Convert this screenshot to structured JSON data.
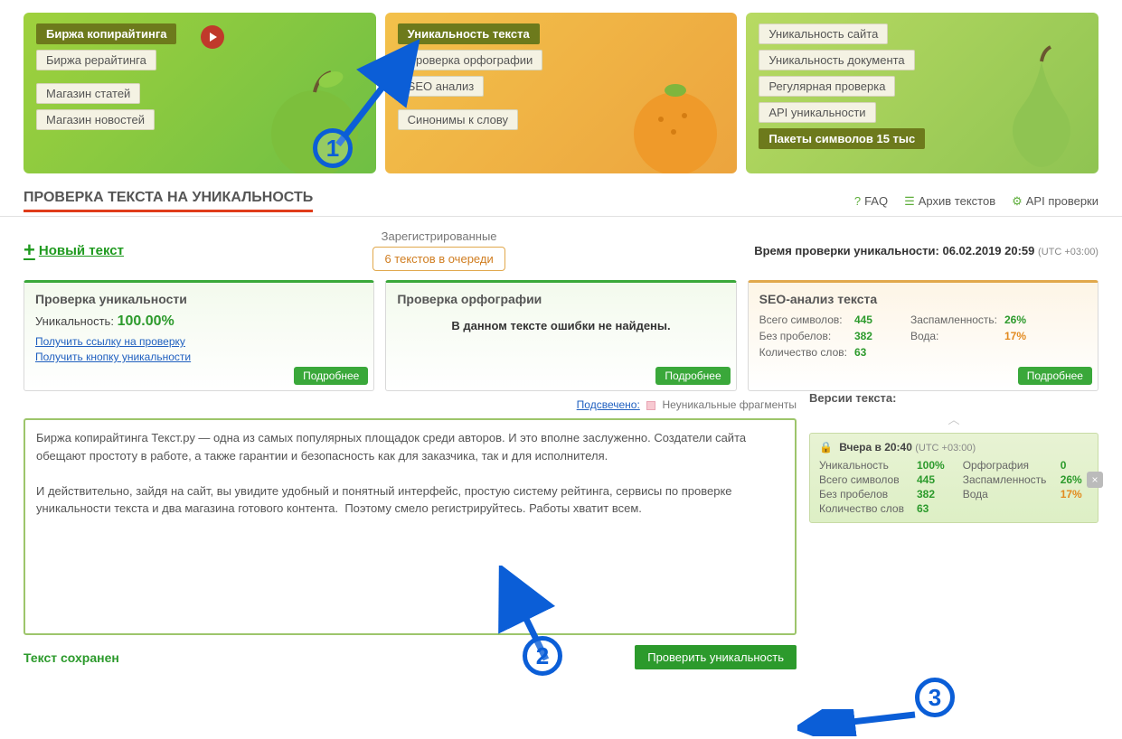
{
  "banners": {
    "left": {
      "items": [
        "Биржа копирайтинга",
        "Биржа рерайтинга",
        "Магазин статей",
        "Магазин новостей"
      ]
    },
    "mid": {
      "items": [
        "Уникальность текста",
        "Проверка орфографии",
        "SEO анализ",
        "Синонимы к слову"
      ],
      "active_index": 0
    },
    "right": {
      "items": [
        "Уникальность сайта",
        "Уникальность документа",
        "Регулярная проверка",
        "API уникальности",
        "Пакеты символов 15 тыс"
      ]
    }
  },
  "page_title": "ПРОВЕРКА ТЕКСТА НА УНИКАЛЬНОСТЬ",
  "toolbar_links": {
    "faq": "FAQ",
    "archive": "Архив текстов",
    "api": "API проверки"
  },
  "new_text": "Новый текст",
  "queue": {
    "registered_label": "Зарегистрированные",
    "status": "6 текстов в очереди"
  },
  "check_time": {
    "label": "Время проверки уникальности:",
    "value": "06.02.2019 20:59",
    "tz": "(UTC +03:00)"
  },
  "cards": {
    "uniq": {
      "title": "Проверка уникальности",
      "label": "Уникальность:",
      "value": "100.00%",
      "link1": "Получить ссылку на проверку",
      "link2": "Получить кнопку уникальности",
      "more": "Подробнее"
    },
    "spell": {
      "title": "Проверка орфографии",
      "msg": "В данном тексте ошибки не найдены.",
      "more": "Подробнее"
    },
    "seo": {
      "title": "SEO-анализ текста",
      "rows_left": [
        {
          "lbl": "Всего символов:",
          "val": "445"
        },
        {
          "lbl": "Без пробелов:",
          "val": "382"
        },
        {
          "lbl": "Количество слов:",
          "val": "63"
        }
      ],
      "rows_right": [
        {
          "lbl": "Заспамленность:",
          "val": "26%"
        },
        {
          "lbl": "Вода:",
          "val": "17%"
        }
      ],
      "more": "Подробнее"
    }
  },
  "legend": {
    "highlighted": "Подсвечено:",
    "nonunique": "Неуникальные фрагменты"
  },
  "editor_text": "Биржа копирайтинга Текст.ру — одна из самых популярных площадок среди авторов. И это вполне заслуженно. Создатели сайта обещают простоту в работе, а также гарантии и безопасность как для заказчика, так и для исполнителя.\n\nИ действительно, зайдя на сайт, вы увидите удобный и понятный интерфейс, простую систему рейтинга, сервисы по проверке уникальности текста и два магазина готового контента.  Поэтому смело регистрируйтесь. Работы хватит всем.",
  "saved_label": "Текст сохранен",
  "check_btn": "Проверить уникальность",
  "versions": {
    "title": "Версии текста:",
    "time_label": "Вчера в 20:40",
    "tz": "(UTC +03:00)",
    "left": [
      {
        "lbl": "Уникальность",
        "val": "100%"
      },
      {
        "lbl": "Всего символов",
        "val": "445"
      },
      {
        "lbl": "Без пробелов",
        "val": "382"
      },
      {
        "lbl": "Количество слов",
        "val": "63"
      }
    ],
    "right": [
      {
        "lbl": "Орфография",
        "val": "0"
      },
      {
        "lbl": "Заспамленность",
        "val": "26%"
      },
      {
        "lbl": "Вода",
        "val": "17%"
      }
    ]
  },
  "annotations": {
    "n1": "1",
    "n2": "2",
    "n3": "3"
  }
}
